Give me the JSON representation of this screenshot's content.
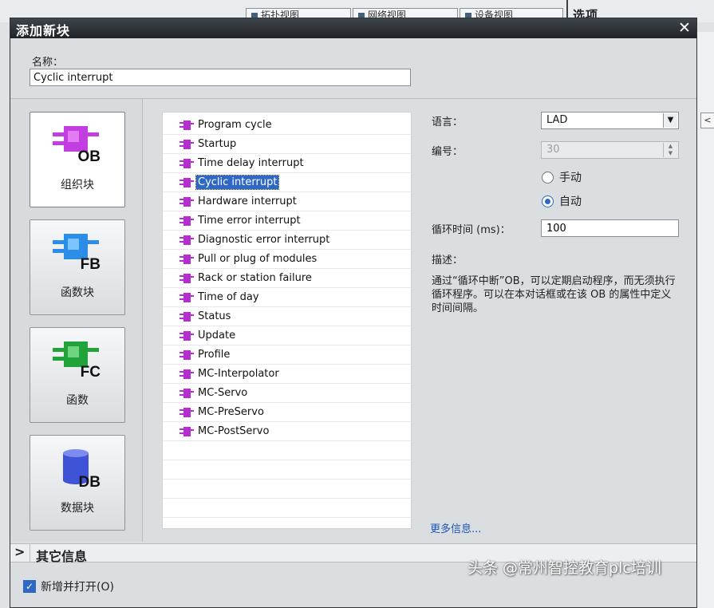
{
  "background": {
    "tabs": [
      "拓扑视图",
      "网络视图",
      "设备视图"
    ],
    "options_label": "选项",
    "right_arrow": "<"
  },
  "dialog": {
    "title": "添加新块",
    "close_label": "✕",
    "name_label": "名称：",
    "name_value": "Cyclic interrupt",
    "block_types": [
      {
        "code": "OB",
        "label": "组织块",
        "color": "#c33ee0",
        "active": true
      },
      {
        "code": "FB",
        "label": "函数块",
        "color": "#2b8de8",
        "active": false
      },
      {
        "code": "FC",
        "label": "函数",
        "color": "#22a33a",
        "active": false
      },
      {
        "code": "DB",
        "label": "数据块",
        "color": "#3f53d6",
        "active": false
      }
    ],
    "ob_list": [
      "Program cycle",
      "Startup",
      "Time delay interrupt",
      "Cyclic interrupt",
      "Hardware interrupt",
      "Time error interrupt",
      "Diagnostic error interrupt",
      "Pull or plug of modules",
      "Rack or station failure",
      "Time of day",
      "Status",
      "Update",
      "Profile",
      "MC-Interpolator",
      "MC-Servo",
      "MC-PreServo",
      "MC-PostServo"
    ],
    "selected_item": "Cyclic interrupt",
    "properties": {
      "language_label": "语言：",
      "language_value": "LAD",
      "number_label": "编号：",
      "number_value": "30",
      "manual_label": "手动",
      "auto_label": "自动",
      "auto_selected": true,
      "cycle_label": "循环时间 (ms)：",
      "cycle_value": "100",
      "description_label": "描述：",
      "description_text": "通过“循环中断”OB，可以定期启动程序，而无须执行循环程序。可以在本对话框或在该 OB 的属性中定义时间间隔。",
      "more_info": "更多信息..."
    },
    "other_info_label": "其它信息",
    "add_open_label": "新增并打开(O)",
    "add_open_checked": true
  },
  "watermark": "头条 @常州智控教育plc培训",
  "colors": {
    "accent": "#2f67c4",
    "titlebar": "#2a2f34",
    "ob_icon": "#b52fd0"
  }
}
